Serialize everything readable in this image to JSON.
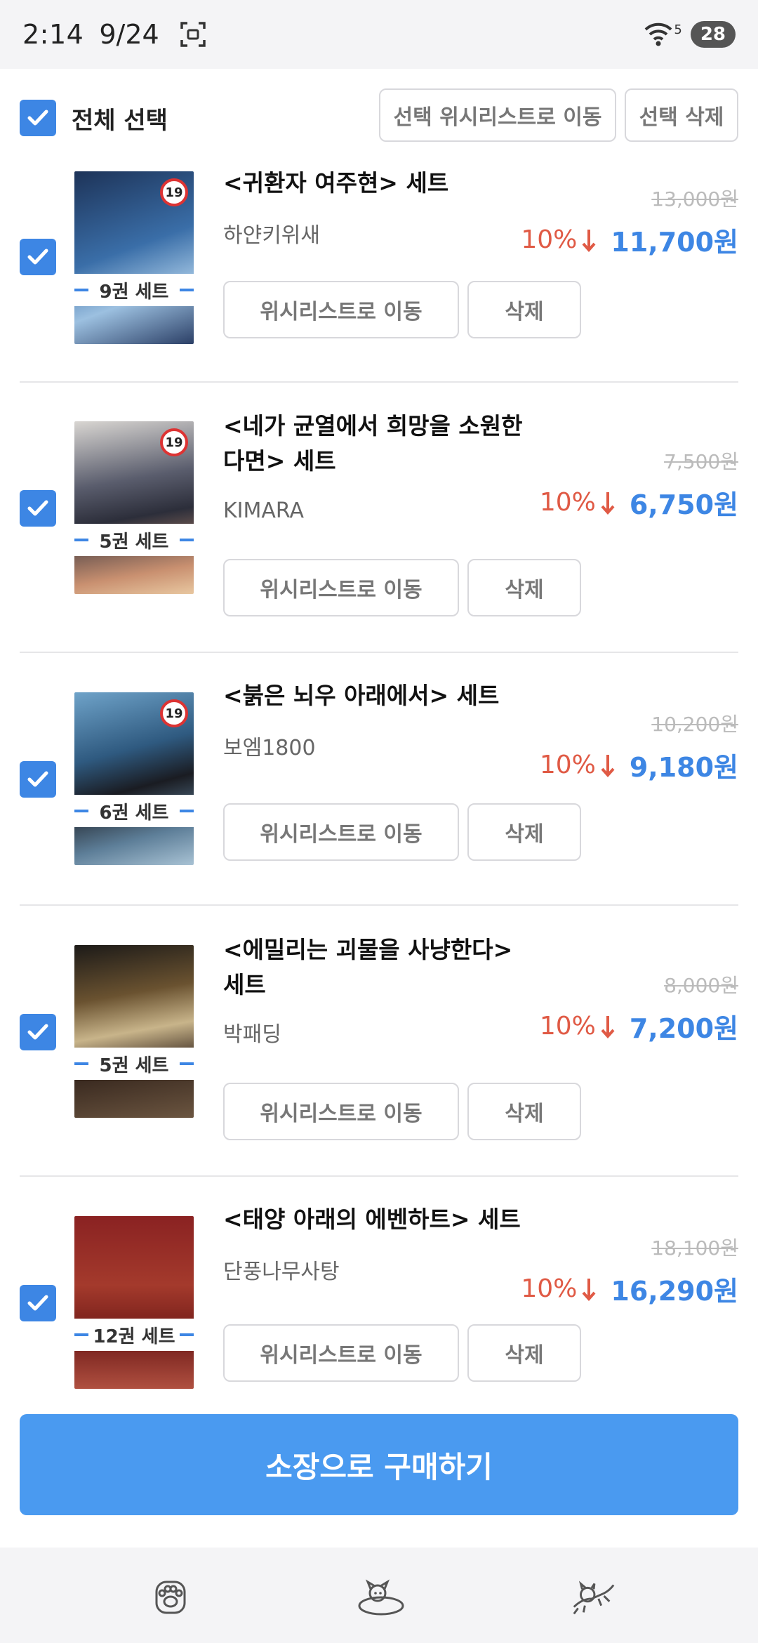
{
  "status_bar": {
    "time": "2:14",
    "date": "9/24",
    "battery": "28",
    "wifi_badge": "5"
  },
  "toolbar": {
    "select_all_label": "전체 선택",
    "move_selected_label": "선택 위시리스트로 이동",
    "delete_selected_label": "선택 삭제"
  },
  "items": [
    {
      "title": "<귀환자 여주현> 세트",
      "author": "하얀키위새",
      "set_label": "9권 세트",
      "age": "19",
      "original_price": "13,000원",
      "discount": "10%",
      "final_price": "11,700원",
      "move_label": "위시리스트로 이동",
      "delete_label": "삭제",
      "cover_colors": [
        "#2b4a78",
        "#8fb3d9"
      ]
    },
    {
      "title": "<네가 균열에서 희망을 소원한다면> 세트",
      "author": "KIMARA",
      "set_label": "5권 세트",
      "age": "19",
      "original_price": "7,500원",
      "discount": "10%",
      "final_price": "6,750원",
      "move_label": "위시리스트로 이동",
      "delete_label": "삭제",
      "cover_colors": [
        "#6d6f7d",
        "#c9a48a"
      ]
    },
    {
      "title": "<붉은 뇌우 아래에서> 세트",
      "author": "보엠1800",
      "set_label": "6권 세트",
      "age": "19",
      "original_price": "10,200원",
      "discount": "10%",
      "final_price": "9,180원",
      "move_label": "위시리스트로 이동",
      "delete_label": "삭제",
      "cover_colors": [
        "#3f6f98",
        "#a9c7dc"
      ]
    },
    {
      "title": "<에밀리는 괴물을 사냥한다> 세트",
      "author": "박패딩",
      "set_label": "5권 세트",
      "age": "",
      "original_price": "8,000원",
      "discount": "10%",
      "final_price": "7,200원",
      "move_label": "위시리스트로 이동",
      "delete_label": "삭제",
      "cover_colors": [
        "#2a221c",
        "#8a6a3a"
      ]
    },
    {
      "title": "<태양 아래의 에벤하트> 세트",
      "author": "단풍나무사탕",
      "set_label": "12권 세트",
      "age": "",
      "original_price": "18,100원",
      "discount": "10%",
      "final_price": "16,290원",
      "move_label": "위시리스트로 이동",
      "delete_label": "삭제",
      "cover_colors": [
        "#7a1d1d",
        "#b94a3a"
      ]
    }
  ],
  "buy_button_label": "소장으로 구매하기",
  "nav": {
    "items": [
      "paw-icon",
      "dog-bed-icon",
      "running-cat-icon"
    ]
  },
  "colors": {
    "accent": "#3d86e4",
    "discount": "#e05a45",
    "buy_button": "#4a9af0"
  }
}
